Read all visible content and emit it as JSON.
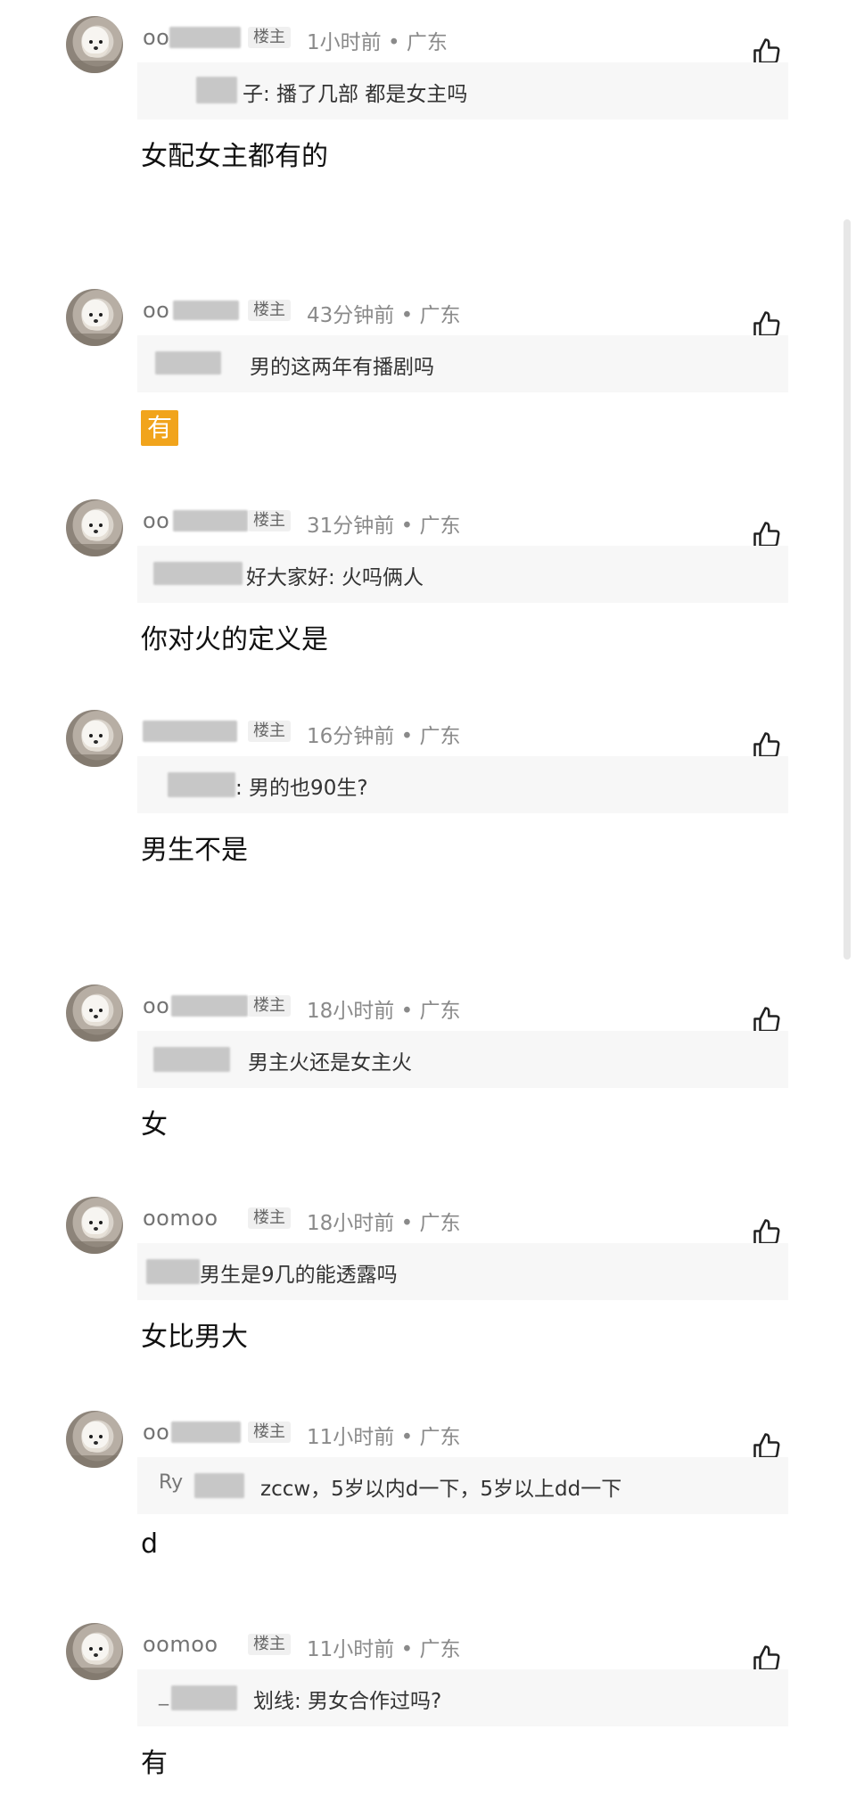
{
  "comments": [
    {
      "username": "oo",
      "tag": "楼主",
      "time": "1小时前 • 广东",
      "quote_prefix": "",
      "quote_text": "子: 播了几部 都是女主吗",
      "reply": "女配女主都有的"
    },
    {
      "username": "oo",
      "tag": "楼主",
      "time": "43分钟前 • 广东",
      "quote_prefix": "",
      "quote_text": "男的这两年有播剧吗",
      "reply": ""
    },
    {
      "username": "oo",
      "tag": "楼主",
      "time": "31分钟前 • 广东",
      "quote_prefix": "",
      "quote_text": "好大家好: 火吗俩人",
      "reply": "你对火的定义是"
    },
    {
      "username": "",
      "tag": "楼主",
      "time": "16分钟前 • 广东",
      "quote_prefix": "",
      "quote_text": ": 男的也90生?",
      "reply": "男生不是"
    },
    {
      "username": "oo",
      "tag": "楼主",
      "time": "18小时前 • 广东",
      "quote_prefix": "",
      "quote_text": "男主火还是女主火",
      "reply": "女"
    },
    {
      "username": "oomoo",
      "tag": "楼主",
      "time": "18小时前 • 广东",
      "quote_prefix": "",
      "quote_text": "男生是9几的能透露吗",
      "reply": "女比男大"
    },
    {
      "username": "oo",
      "tag": "楼主",
      "time": "11小时前 • 广东",
      "quote_prefix": "Ry",
      "quote_text": "zccw，5岁以内d一下，5岁以上dd一下",
      "reply": "d"
    },
    {
      "username": "oomoo",
      "tag": "楼主",
      "time": "11小时前 • 广东",
      "quote_prefix": "_",
      "quote_text": "划线: 男女合作过吗?",
      "reply": "有"
    }
  ],
  "badge_text": "有",
  "icons": {
    "avatar": "avatar",
    "like": "thumb-up-icon"
  }
}
